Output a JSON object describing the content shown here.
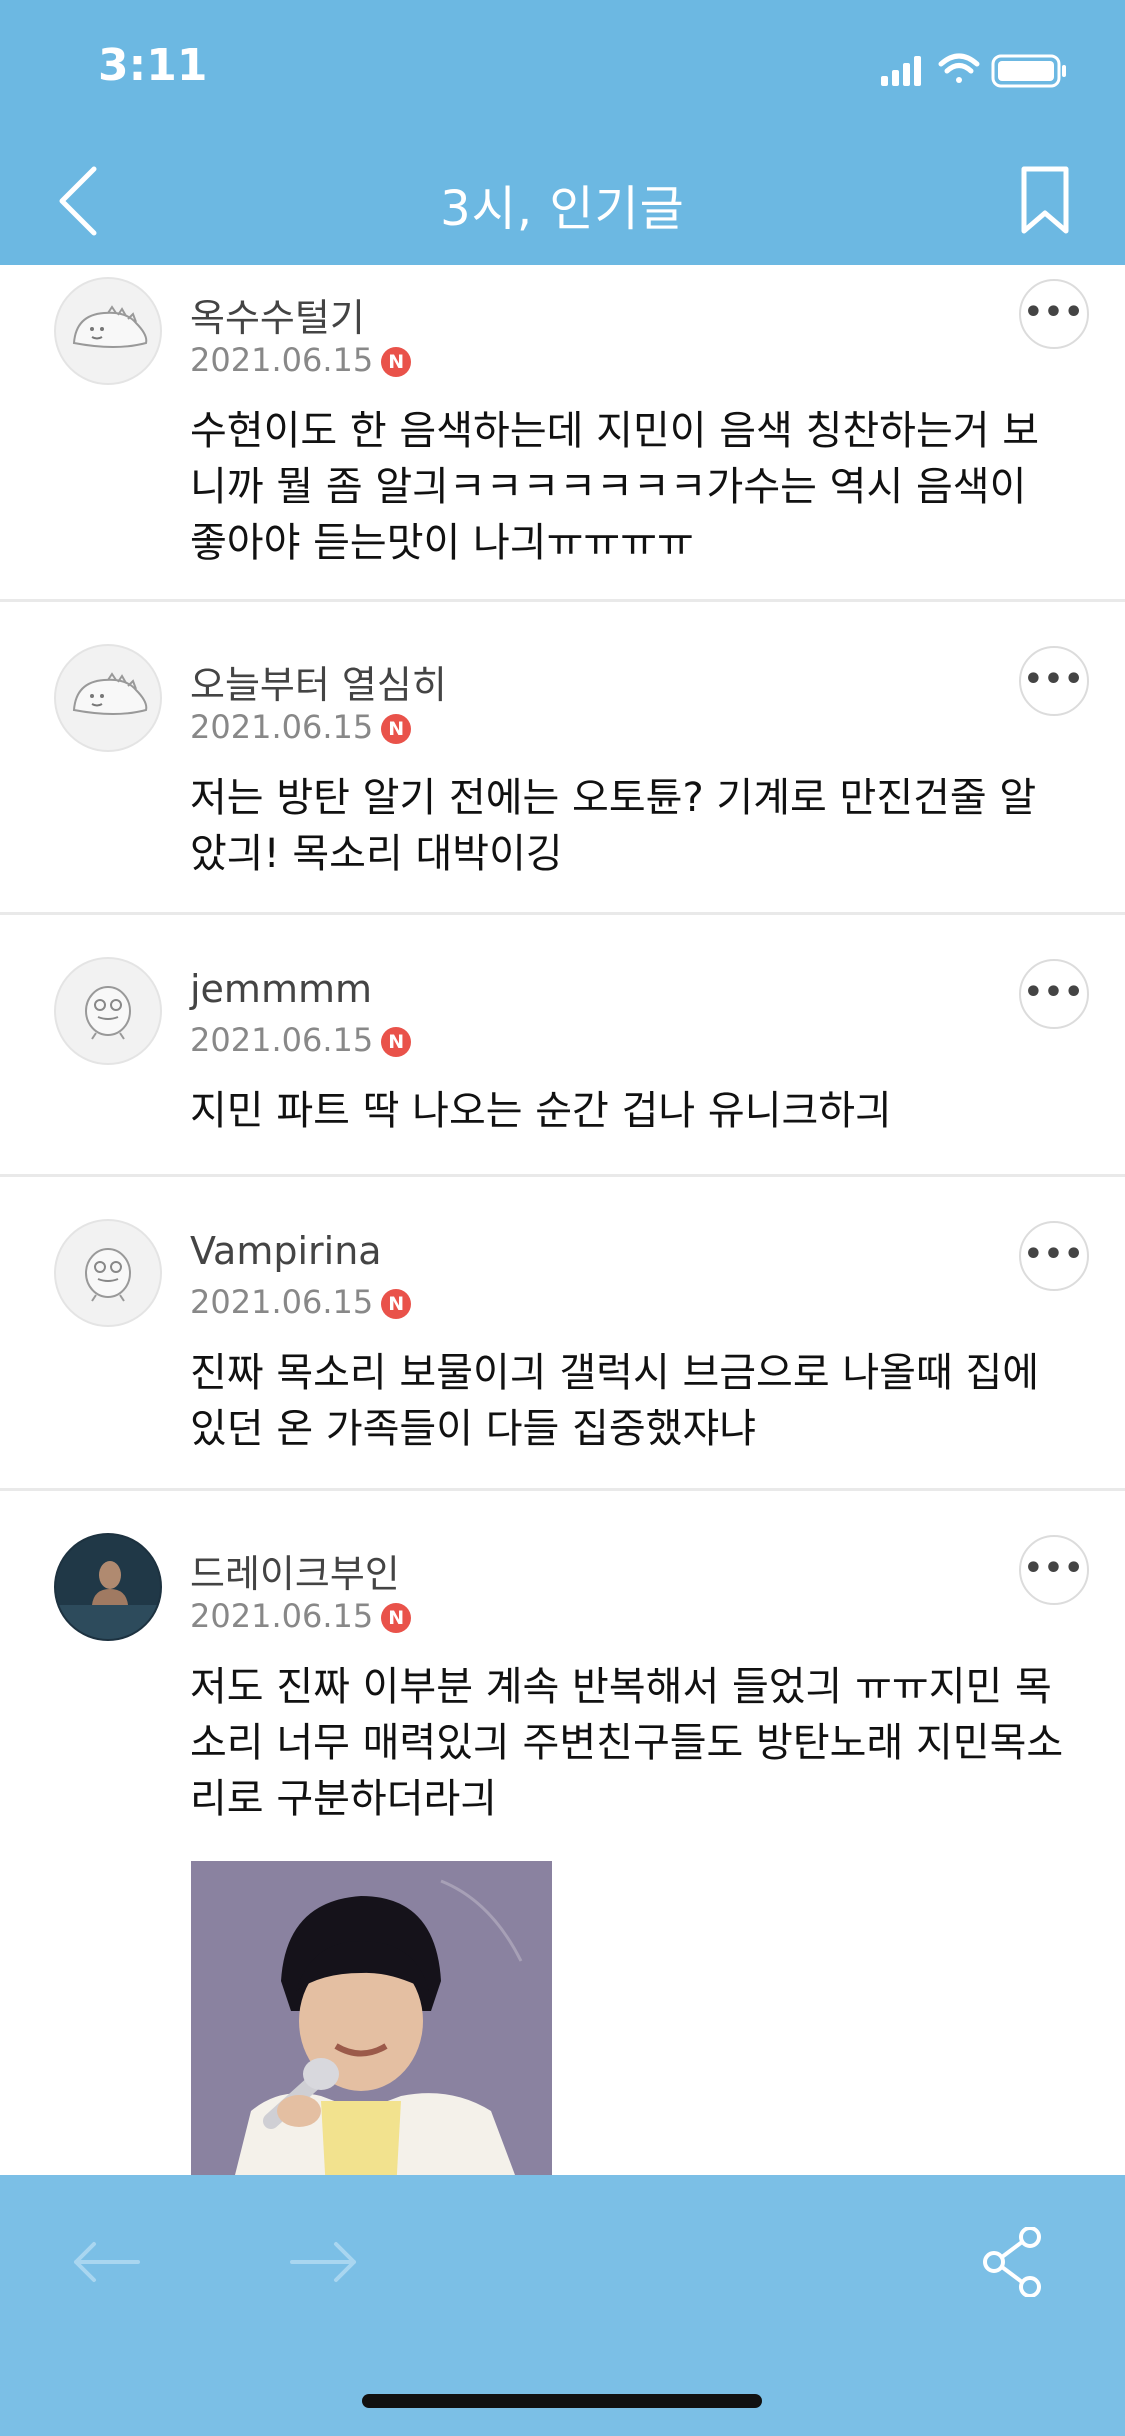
{
  "status_bar": {
    "time": "3:11"
  },
  "nav": {
    "title": "3시, 인기글"
  },
  "comments": [
    {
      "author": "옥수수털기",
      "date": "2021.06.15",
      "badge": "N",
      "text": "수현이도 한 음색하는데 지민이 음색 칭찬하는거 보니까 뭘 좀 알긔ㅋㅋㅋㅋㅋㅋㅋ가수는 역시 음색이 좋아야 듣는맛이 나긔ㅠㅠㅠㅠ",
      "avatar": "dino-avatar-icon"
    },
    {
      "author": "오늘부터 열심히",
      "date": "2021.06.15",
      "badge": "N",
      "text": "저는 방탄 알기 전에는 오토튠? 기계로 만진건줄 알았긔! 목소리 대박이깅",
      "avatar": "dino-avatar-icon"
    },
    {
      "author": "jemmmm",
      "date": "2021.06.15",
      "badge": "N",
      "text": "지민 파트 딱 나오는 순간 겁나 유니크하긔",
      "avatar": "creature-avatar-icon"
    },
    {
      "author": "Vampirina",
      "date": "2021.06.15",
      "badge": "N",
      "text": "진짜 목소리 보물이긔 갤럭시 브금으로 나올때 집에 있던 온 가족들이 다들 집중했쟈냐",
      "avatar": "creature-avatar-icon"
    },
    {
      "author": "드레이크부인",
      "date": "2021.06.15",
      "badge": "N",
      "text": "저도 진짜 이부분 계속 반복해서 들었긔 ㅠㅠ지민 목소리 너무 매력있긔 주변친구들도 방탄노래 지민목소리로 구분하더라긔",
      "avatar": "photo-avatar"
    }
  ],
  "colors": {
    "header_bg": "#6cb8e2",
    "toolbar_bg": "#7bbfe6",
    "badge": "#e9524a"
  }
}
